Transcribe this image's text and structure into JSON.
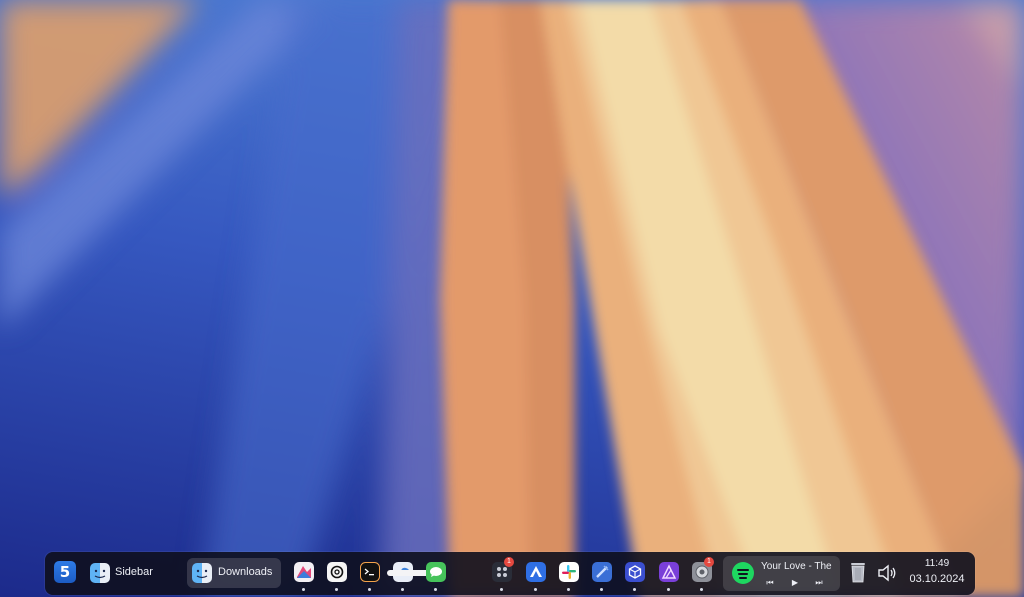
{
  "wallpaper": {
    "colors": {
      "deep_blue": "#1f2c8e",
      "blue": "#3d63c8",
      "purple": "#8b6fb8",
      "orange": "#e69a5c",
      "peach": "#f0c28a",
      "cream": "#f2dcaa"
    }
  },
  "taskbar": {
    "launcher": {
      "label": "5",
      "icon": "app-launcher-icon"
    },
    "sidebar_button": {
      "label": "Sidebar",
      "icon": "finder-icon"
    },
    "downloads_button": {
      "label": "Downloads",
      "icon": "finder-icon"
    },
    "apps": [
      {
        "name": "app-store-like-icon",
        "running": true
      },
      {
        "name": "chatgpt-icon",
        "running": true
      },
      {
        "name": "terminal-icon",
        "running": true
      },
      {
        "name": "cloud-app-icon",
        "running": true
      },
      {
        "name": "messages-icon",
        "running": true
      },
      {
        "name": "app-grid-icon",
        "running": true,
        "badge": "1"
      },
      {
        "name": "triangle-app-icon",
        "running": true
      },
      {
        "name": "slack-icon",
        "running": true
      },
      {
        "name": "xcode-icon",
        "running": true
      },
      {
        "name": "cube-app-icon",
        "running": true
      },
      {
        "name": "affinity-icon",
        "running": true
      },
      {
        "name": "system-settings-icon",
        "running": true,
        "badge": "1"
      }
    ],
    "media": {
      "title": "Your Love - The",
      "prev": "⏮",
      "play": "▶",
      "next": "⏭",
      "icon": "spotify-icon"
    },
    "trash_icon": "trash-icon",
    "volume_icon": "volume-icon",
    "clock": {
      "time": "11:49",
      "date": "03.10.2024"
    }
  }
}
